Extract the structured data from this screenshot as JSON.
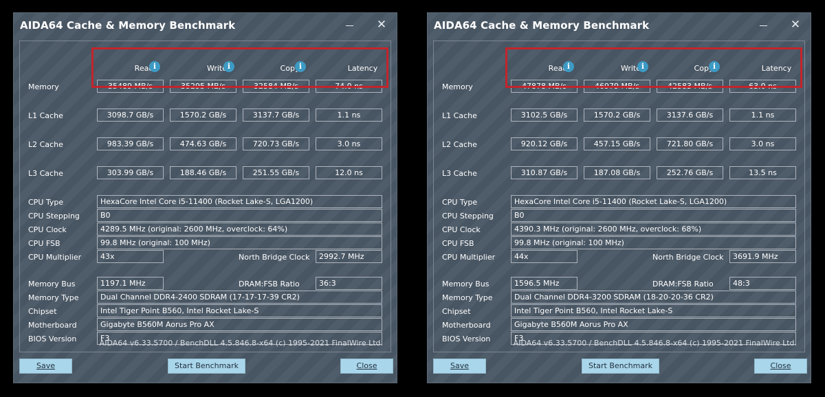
{
  "left": {
    "title": "AIDA64 Cache & Memory Benchmark",
    "headers": [
      "Read",
      "Write",
      "Copy",
      "Latency"
    ],
    "rows": [
      {
        "label": "Memory",
        "values": [
          "35489 MB/s",
          "35295 MB/s",
          "32584 MB/s",
          "74.0 ns"
        ]
      },
      {
        "label": "L1 Cache",
        "values": [
          "3098.7 GB/s",
          "1570.2 GB/s",
          "3137.7 GB/s",
          "1.1 ns"
        ]
      },
      {
        "label": "L2 Cache",
        "values": [
          "983.39 GB/s",
          "474.63 GB/s",
          "720.73 GB/s",
          "3.0 ns"
        ]
      },
      {
        "label": "L3 Cache",
        "values": [
          "303.99 GB/s",
          "188.46 GB/s",
          "251.55 GB/s",
          "12.0 ns"
        ]
      }
    ],
    "cpu_type_label": "CPU Type",
    "cpu_type": "HexaCore Intel Core i5-11400  (Rocket Lake-S, LGA1200)",
    "cpu_stepping_label": "CPU Stepping",
    "cpu_stepping": "B0",
    "cpu_clock_label": "CPU Clock",
    "cpu_clock": "4289.5 MHz  (original: 2600 MHz, overclock: 64%)",
    "cpu_fsb_label": "CPU FSB",
    "cpu_fsb": "99.8 MHz  (original: 100 MHz)",
    "cpu_multiplier_label": "CPU Multiplier",
    "cpu_multiplier": "43x",
    "nb_clock_label": "North Bridge Clock",
    "nb_clock": "2992.7 MHz",
    "memory_bus_label": "Memory Bus",
    "memory_bus": "1197.1 MHz",
    "dram_ratio_label": "DRAM:FSB Ratio",
    "dram_ratio": "36:3",
    "memory_type_label": "Memory Type",
    "memory_type": "Dual Channel DDR4-2400 SDRAM  (17-17-17-39 CR2)",
    "chipset_label": "Chipset",
    "chipset": "Intel Tiger Point B560, Intel Rocket Lake-S",
    "motherboard_label": "Motherboard",
    "motherboard": "Gigabyte B560M Aorus Pro AX",
    "bios_label": "BIOS Version",
    "bios": "F3",
    "footer": "AIDA64 v6.33.5700 / BenchDLL 4.5.846.8-x64  (c) 1995-2021 FinalWire Ltd.",
    "save_label": "Save",
    "start_label": "Start Benchmark",
    "close_label": "Close"
  },
  "right": {
    "title": "AIDA64 Cache & Memory Benchmark",
    "headers": [
      "Read",
      "Write",
      "Copy",
      "Latency"
    ],
    "rows": [
      {
        "label": "Memory",
        "values": [
          "47878 MB/s",
          "46979 MB/s",
          "42583 MB/s",
          "63.0 ns"
        ]
      },
      {
        "label": "L1 Cache",
        "values": [
          "3102.5 GB/s",
          "1570.2 GB/s",
          "3137.6 GB/s",
          "1.1 ns"
        ]
      },
      {
        "label": "L2 Cache",
        "values": [
          "920.12 GB/s",
          "457.15 GB/s",
          "721.80 GB/s",
          "3.0 ns"
        ]
      },
      {
        "label": "L3 Cache",
        "values": [
          "310.87 GB/s",
          "187.08 GB/s",
          "252.76 GB/s",
          "13.5 ns"
        ]
      }
    ],
    "cpu_type_label": "CPU Type",
    "cpu_type": "HexaCore Intel Core i5-11400  (Rocket Lake-S, LGA1200)",
    "cpu_stepping_label": "CPU Stepping",
    "cpu_stepping": "B0",
    "cpu_clock_label": "CPU Clock",
    "cpu_clock": "4390.3 MHz  (original: 2600 MHz, overclock: 68%)",
    "cpu_fsb_label": "CPU FSB",
    "cpu_fsb": "99.8 MHz  (original: 100 MHz)",
    "cpu_multiplier_label": "CPU Multiplier",
    "cpu_multiplier": "44x",
    "nb_clock_label": "North Bridge Clock",
    "nb_clock": "3691.9 MHz",
    "memory_bus_label": "Memory Bus",
    "memory_bus": "1596.5 MHz",
    "dram_ratio_label": "DRAM:FSB Ratio",
    "dram_ratio": "48:3",
    "memory_type_label": "Memory Type",
    "memory_type": "Dual Channel DDR4-3200 SDRAM  (18-20-20-36 CR2)",
    "chipset_label": "Chipset",
    "chipset": "Intel Tiger Point B560, Intel Rocket Lake-S",
    "motherboard_label": "Motherboard",
    "motherboard": "Gigabyte B560M Aorus Pro AX",
    "bios_label": "BIOS Version",
    "bios": "F3",
    "footer": "AIDA64 v6.33.5700 / BenchDLL 4.5.846.8-x64  (c) 1995-2021 FinalWire Ltd.",
    "save_label": "Save",
    "start_label": "Start Benchmark",
    "close_label": "Close"
  }
}
